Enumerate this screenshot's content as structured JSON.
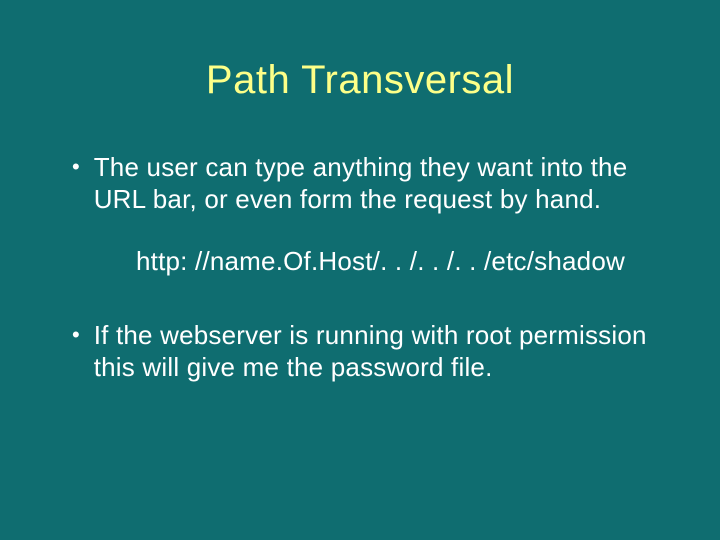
{
  "slide": {
    "title": "Path Transversal",
    "bullets": {
      "first": "The user can type anything they want into the URL bar, or even form the request by hand.",
      "example": "http: //name.Of.Host/. . /. . /. . /etc/shadow",
      "second": "If the webserver is running with root permission this will give me the password file."
    },
    "marker": "•"
  }
}
